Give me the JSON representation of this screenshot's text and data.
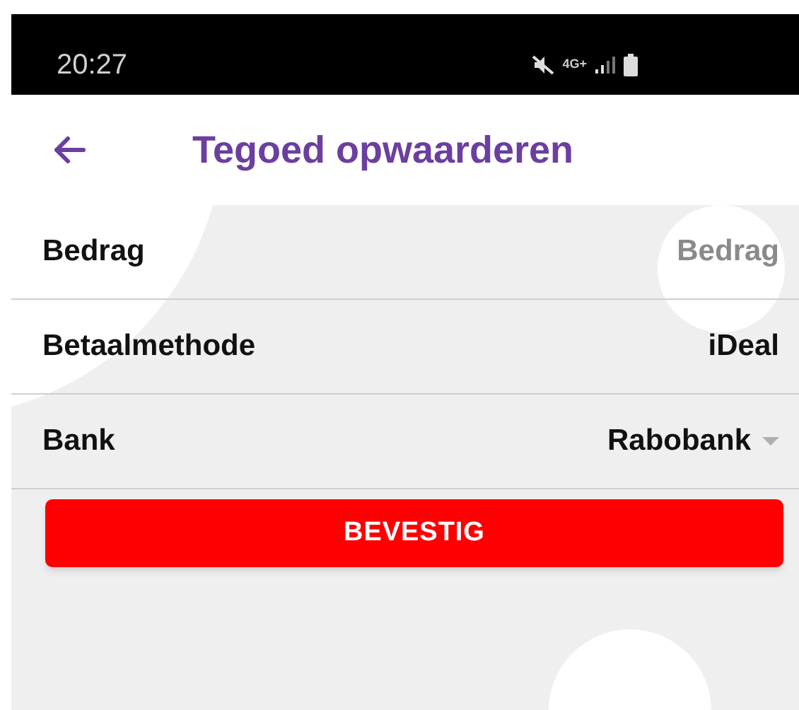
{
  "status_bar": {
    "time": "20:27",
    "network": "4G+"
  },
  "header": {
    "title": "Tegoed opwaarderen"
  },
  "form_rows": [
    {
      "kind": "input",
      "label": "Bedrag",
      "placeholder": "Bedrag"
    },
    {
      "kind": "text",
      "label": "Betaalmethode",
      "value": "iDeal"
    },
    {
      "kind": "dropdown",
      "label": "Bank",
      "value": "Rabobank"
    }
  ],
  "confirm_button": {
    "label": "BEVESTIG"
  }
}
